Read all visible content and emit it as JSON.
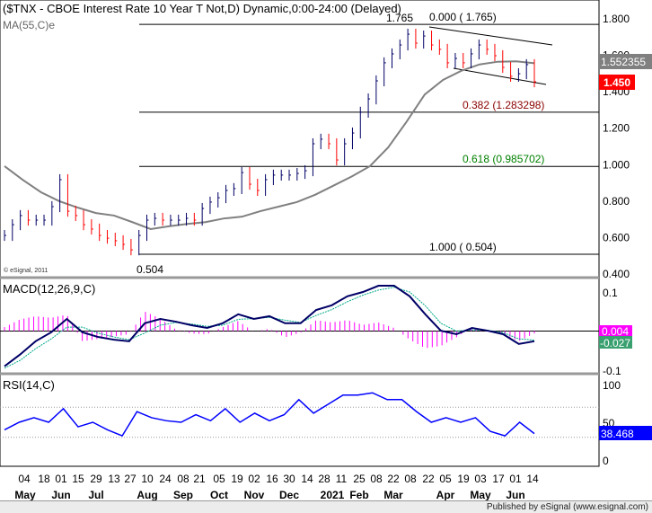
{
  "header": {
    "title": "($TNX - CBOE Interest Rate 10 Year T Not,D) Dynamic,0:00-24:00 (Delayed)",
    "ma_label": "MA(55,C)e",
    "copyright": "© eSignal, 2011"
  },
  "footer": {
    "text": "Published by eSignal (www.esignal.com)"
  },
  "chart_data": [
    {
      "type": "line",
      "panel": "price",
      "ylim": [
        0.4,
        1.8
      ],
      "yticks": [
        "1.800",
        "1.600",
        "1.400",
        "1.200",
        "1.000",
        "0.800",
        "0.600",
        "0.400"
      ],
      "close": [
        0.607,
        0.666,
        0.716,
        0.691,
        0.691,
        0.691,
        0.765,
        0.913,
        0.74,
        0.716,
        0.666,
        0.642,
        0.607,
        0.592,
        0.578,
        0.558,
        0.528,
        0.607,
        0.691,
        0.701,
        0.691,
        0.691,
        0.691,
        0.701,
        0.691,
        0.755,
        0.79,
        0.814,
        0.854,
        0.864,
        0.952,
        0.888,
        0.854,
        0.913,
        0.938,
        0.938,
        0.938,
        0.947,
        0.962,
        1.11,
        1.135,
        1.11,
        1.021,
        1.11,
        1.169,
        1.283,
        1.356,
        1.455,
        1.554,
        1.603,
        1.652,
        1.711,
        1.662,
        1.701,
        1.652,
        1.628,
        1.554,
        1.578,
        1.554,
        1.603,
        1.652,
        1.628,
        1.593,
        1.529,
        1.48,
        1.494,
        1.544,
        1.45
      ],
      "ma55": [
        0.987,
        0.912,
        0.844,
        0.795,
        0.76,
        0.73,
        0.716,
        0.68,
        0.642,
        0.657,
        0.67,
        0.68,
        0.7,
        0.71,
        0.74,
        0.765,
        0.79,
        0.83,
        0.88,
        0.93,
        0.987,
        1.09,
        1.23,
        1.38,
        1.46,
        1.51,
        1.545,
        1.56,
        1.562,
        1.552
      ],
      "current_ma": "1.552355",
      "current_price": "1.450",
      "fib_levels": [
        {
          "ratio": "0.000",
          "value": 1.765,
          "label": "0.000 ( 1.765)",
          "color": "#000000"
        },
        {
          "ratio": "0.382",
          "value": 1.283298,
          "label": "0.382 (1.283298)",
          "color": "#8b0000"
        },
        {
          "ratio": "0.618",
          "value": 0.985702,
          "label": "0.618 (0.985702)",
          "color": "#008000"
        },
        {
          "ratio": "1.000",
          "value": 0.504,
          "label": "1.000 ( 0.504)",
          "color": "#000000"
        }
      ],
      "high_label": "1.765",
      "low_label": "0.504",
      "colors": {
        "up": "#000066",
        "down": "#ff0000",
        "ma": "#808080",
        "price_tag": "#ff0000",
        "ma_tag": "#808080"
      }
    },
    {
      "type": "line",
      "panel": "macd",
      "title": "MACD(12,26,9,C)",
      "ylim": [
        -0.1,
        0.1
      ],
      "yticks": [
        "0.1",
        "-0.1"
      ],
      "macd": [
        -0.09,
        -0.06,
        -0.026,
        -0.003,
        0.031,
        -0.003,
        -0.015,
        -0.022,
        -0.026,
        0.02,
        0.031,
        0.024,
        0.015,
        0.008,
        0.02,
        0.043,
        0.031,
        0.038,
        0.02,
        0.02,
        0.054,
        0.066,
        0.089,
        0.1,
        0.116,
        0.116,
        0.089,
        0.043,
        0.001,
        -0.008,
        0.008,
        0.001,
        -0.008,
        -0.033,
        -0.026
      ],
      "signal": [
        -0.095,
        -0.075,
        -0.045,
        -0.02,
        0.01,
        0.01,
        -0.005,
        -0.015,
        -0.022,
        -0.005,
        0.015,
        0.022,
        0.018,
        0.012,
        0.015,
        0.03,
        0.032,
        0.035,
        0.028,
        0.022,
        0.04,
        0.055,
        0.075,
        0.092,
        0.105,
        0.112,
        0.1,
        0.065,
        0.02,
        0.0,
        0.003,
        0.002,
        -0.004,
        -0.02,
        -0.023
      ],
      "histogram_value": "0.004",
      "macd_value": "-0.027",
      "colors": {
        "macd": "#000066",
        "signal": "#00aa88",
        "hist": "#ff00ff"
      }
    },
    {
      "type": "line",
      "panel": "rsi",
      "title": "RSI(14,C)",
      "ylim": [
        0,
        100
      ],
      "yticks": [
        "100",
        "50",
        "0"
      ],
      "levels": [
        70,
        30
      ],
      "rsi": [
        40,
        50,
        56,
        50,
        68,
        44,
        50,
        40,
        32,
        64,
        56,
        52,
        50,
        60,
        52,
        68,
        50,
        62,
        52,
        60,
        80,
        62,
        74,
        86,
        86,
        89,
        80,
        80,
        64,
        50,
        56,
        50,
        56,
        38,
        32,
        50,
        35
      ],
      "current": "38.468",
      "color": "#0000ff"
    },
    {
      "type": "axis",
      "x_ticks": [
        "04",
        "18",
        "01",
        "15",
        "29",
        "13",
        "27",
        "10",
        "24",
        "08",
        "21",
        "05",
        "19",
        "02",
        "16",
        "30",
        "14",
        "28",
        "11",
        "25",
        "08",
        "22",
        "08",
        "22",
        "05",
        "19",
        "03",
        "17",
        "01",
        "14"
      ],
      "months": [
        "May",
        "Jun",
        "Jul",
        "Aug",
        "Sep",
        "Oct",
        "Nov",
        "Dec",
        "2021",
        "Feb",
        "Mar",
        "Apr",
        "May",
        "Jun"
      ]
    }
  ]
}
